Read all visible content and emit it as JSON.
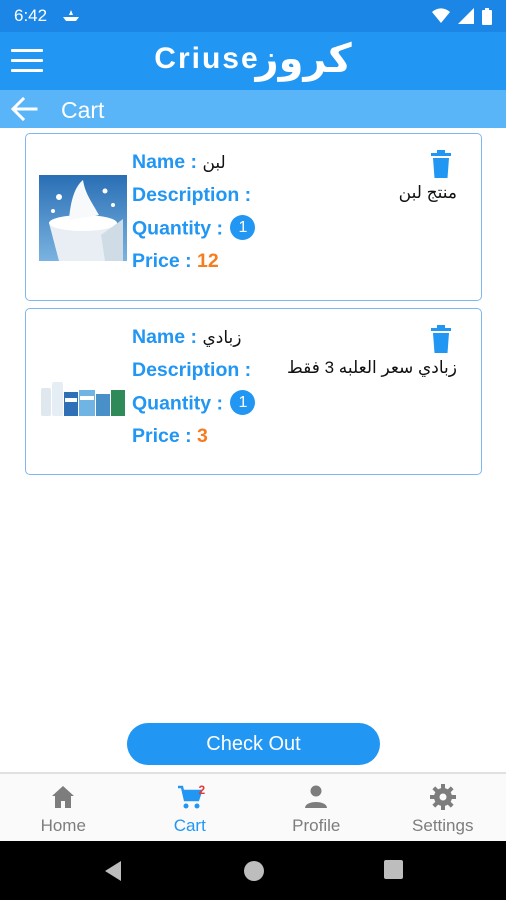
{
  "status_bar": {
    "time": "6:42"
  },
  "app_bar": {
    "logo_latin": "Criuse",
    "logo_arabic": "كروز",
    "menu_icon": "hamburger-menu-icon"
  },
  "sub_bar": {
    "title": "Cart",
    "back_icon": "arrow-left-icon"
  },
  "labels": {
    "name": "Name : ",
    "description": "Description :",
    "quantity": "Quantity : ",
    "price": "Price : "
  },
  "cart_items": [
    {
      "name": "لبن",
      "description": "منتج لبن",
      "quantity": "1",
      "price": "12",
      "image": "milk-splash-image"
    },
    {
      "name": "زبادي",
      "description": "زبادي سعر العلبه 3 فقط",
      "quantity": "1",
      "price": "3",
      "image": "yogurt-products-image"
    }
  ],
  "checkout_label": "Check Out",
  "bottom_nav": {
    "items": [
      {
        "label": "Home",
        "icon": "home-icon"
      },
      {
        "label": "Cart",
        "icon": "cart-icon",
        "badge": "2"
      },
      {
        "label": "Profile",
        "icon": "person-icon"
      },
      {
        "label": "Settings",
        "icon": "gear-icon"
      }
    ]
  },
  "colors": {
    "primary": "#2196f3",
    "status_bar": "#1c86e6",
    "sub_bar": "#5ab4f8",
    "price": "#f57c1f",
    "badge": "#e53935"
  }
}
